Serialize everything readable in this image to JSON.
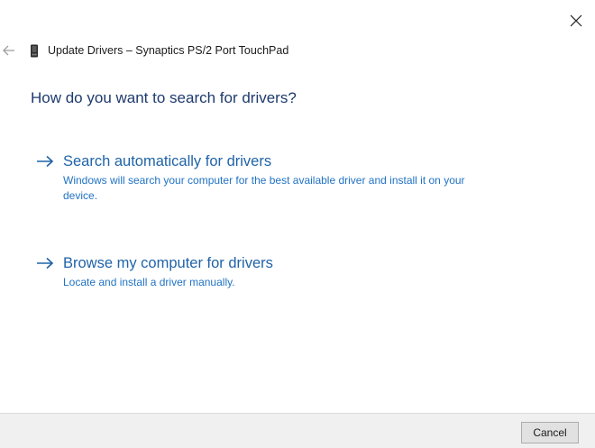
{
  "window": {
    "title": "Update Drivers – Synaptics PS/2 Port TouchPad",
    "close_icon": "close-icon",
    "back_icon": "back-arrow-icon",
    "device_icon": "touchpad-device-icon"
  },
  "main": {
    "question": "How do you want to search for drivers?",
    "options": [
      {
        "title": "Search automatically for drivers",
        "description": "Windows will search your computer for the best available driver and install it on your device."
      },
      {
        "title": "Browse my computer for drivers",
        "description": "Locate and install a driver manually."
      }
    ]
  },
  "footer": {
    "cancel_label": "Cancel"
  },
  "colors": {
    "heading": "#1e3a6e",
    "link": "#1f63a8",
    "link_desc": "#2173c4",
    "footer_bg": "#f0f0f0"
  }
}
